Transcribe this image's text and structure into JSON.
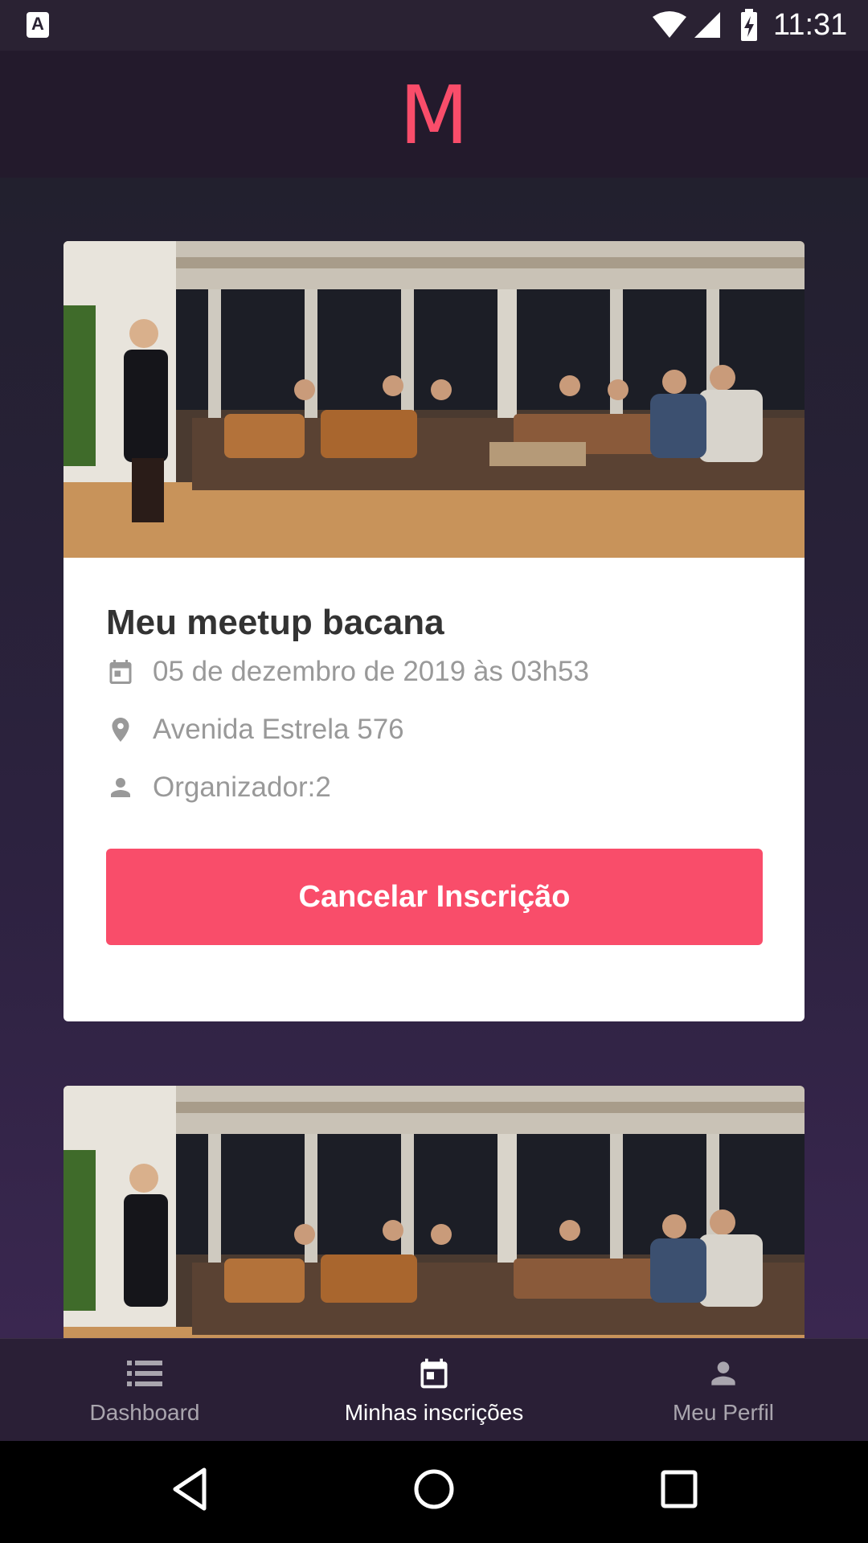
{
  "status_bar": {
    "time": "11:31",
    "notification_icon": "A"
  },
  "header": {
    "logo": "M",
    "accent_color": "#f94d6a"
  },
  "cards": [
    {
      "title": "Meu meetup bacana",
      "date": "05 de dezembro de 2019 às 03h53",
      "location": "Avenida Estrela 576",
      "organizer": "Organizador:2",
      "button_label": "Cancelar Inscrição"
    }
  ],
  "tabs": [
    {
      "label": "Dashboard",
      "icon": "list-icon",
      "active": false
    },
    {
      "label": "Minhas inscrições",
      "icon": "calendar-icon",
      "active": true
    },
    {
      "label": "Meu Perfil",
      "icon": "person-icon",
      "active": false
    }
  ]
}
